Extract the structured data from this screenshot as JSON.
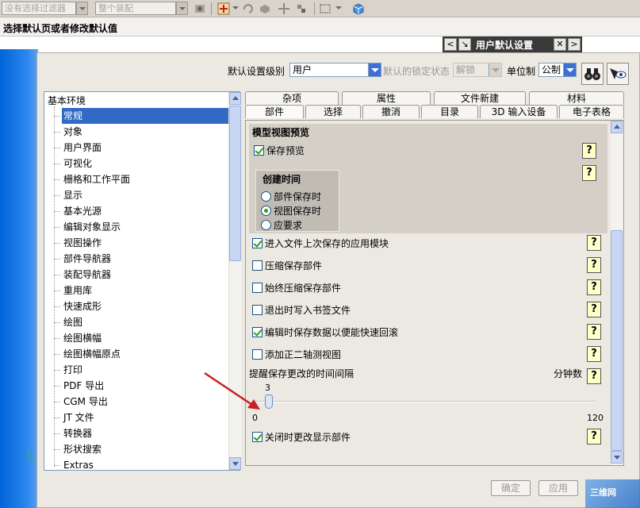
{
  "toolbar": {
    "filter_combo": "没有选择过滤器",
    "scope_combo": "整个装配"
  },
  "hint": "选择默认页或者修改默认值",
  "dialog": {
    "title": "用户默认设置",
    "level_label": "默认设置级别",
    "level_value": "用户",
    "lock_label": "默认的锁定状态",
    "lock_value": "解锁",
    "unit_label": "单位制",
    "unit_value": "公制"
  },
  "tree": {
    "root": "基本环境",
    "items": [
      "常规",
      "对象",
      "用户界面",
      "可视化",
      "栅格和工作平面",
      "显示",
      "基本光源",
      "编辑对象显示",
      "视图操作",
      "部件导航器",
      "装配导航器",
      "重用库",
      "快速成形",
      "绘图",
      "绘图横幅",
      "绘图横幅原点",
      "打印",
      "PDF 导出",
      "CGM 导出",
      "JT 文件",
      "转换器",
      "形状搜索",
      "Extras"
    ],
    "active_index": 0
  },
  "tabs": {
    "row1": [
      "杂项",
      "属性",
      "文件新建",
      "材料"
    ],
    "row2": [
      "部件",
      "选择",
      "撤消",
      "目录",
      "3D 输入设备",
      "电子表格"
    ],
    "active": "部件"
  },
  "panel": {
    "group_title": "模型视图预览",
    "save_preview": "保存预览",
    "creation_title": "创建时间",
    "radio_options": [
      "部件保存时",
      "视图保存时",
      "应要求"
    ],
    "radio_selected": 1,
    "options": [
      {
        "label": "进入文件上次保存的应用模块",
        "checked": true
      },
      {
        "label": "压缩保存部件",
        "checked": false
      },
      {
        "label": "始终压缩保存部件",
        "checked": false
      },
      {
        "label": "退出时写入书签文件",
        "checked": false
      },
      {
        "label": "编辑时保存数据以便能快速回滚",
        "checked": true
      },
      {
        "label": "添加正二轴测视图",
        "checked": false
      }
    ],
    "interval_label": "提醒保存更改的时间间隔",
    "interval_unit": "分钟数",
    "interval_value": "3",
    "interval_min": "0",
    "interval_max": "120",
    "close_label": "关闭时更改显示部件",
    "help_glyph": "?"
  },
  "buttons": {
    "ok": "确定",
    "apply": "应用"
  },
  "watermark": "三维网"
}
